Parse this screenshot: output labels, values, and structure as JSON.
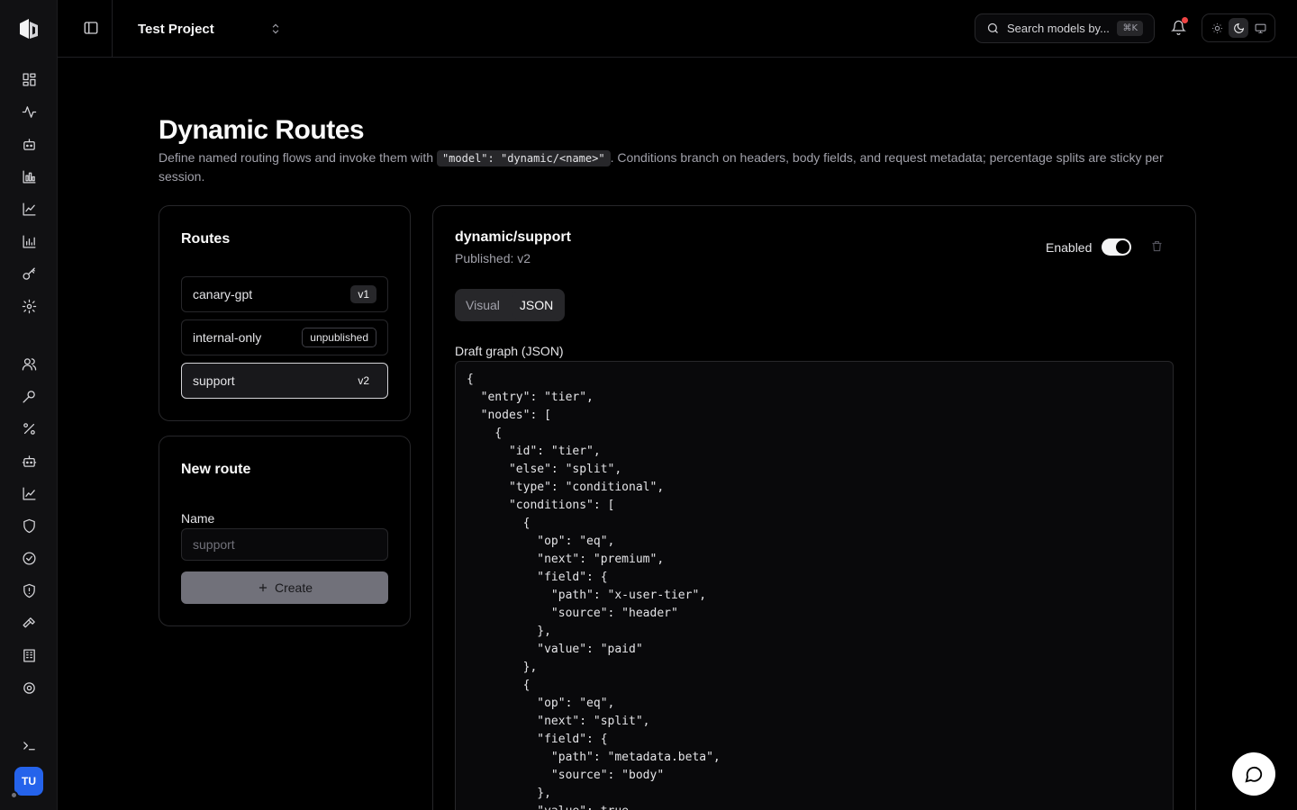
{
  "topbar": {
    "project_name": "Test Project",
    "search_placeholder": "Search models by...",
    "search_shortcut": "⌘K"
  },
  "rail": {
    "avatar_initials": "TU",
    "icons": [
      "dashboard-icon",
      "activity-icon",
      "bot-icon",
      "bar-chart-icon",
      "line-chart-icon",
      "column-chart-icon",
      "key-icon",
      "settings-icon",
      "users-icon",
      "wrench-icon",
      "percent-icon",
      "robot-icon",
      "trend-icon",
      "shield-icon",
      "check-circle-icon",
      "shield-alert-icon",
      "hammer-icon",
      "building-icon",
      "cog-icon",
      "terminal-icon"
    ]
  },
  "header": {
    "title": "Dynamic Routes",
    "desc_before": "Define named routing flows and invoke them with ",
    "desc_code": "\"model\": \"dynamic/<name>\"",
    "desc_after": ". Conditions branch on headers, body fields, and request metadata; percentage splits are sticky per session."
  },
  "routes_card": {
    "title": "Routes",
    "items": [
      {
        "name": "canary-gpt",
        "badge": "v1"
      },
      {
        "name": "internal-only",
        "badge": "unpublished"
      },
      {
        "name": "support",
        "badge": "v2"
      }
    ]
  },
  "new_route": {
    "title": "New route",
    "name_label": "Name",
    "name_placeholder": "support",
    "create_label": "Create"
  },
  "detail": {
    "title": "dynamic/support",
    "subtitle": "Published: v2",
    "enabled_label": "Enabled",
    "enabled": true,
    "tabs": [
      "Visual",
      "JSON"
    ],
    "active_tab": "JSON",
    "editor_label": "Draft graph (JSON)",
    "editor_text": "{\n  \"entry\": \"tier\",\n  \"nodes\": [\n    {\n      \"id\": \"tier\",\n      \"else\": \"split\",\n      \"type\": \"conditional\",\n      \"conditions\": [\n        {\n          \"op\": \"eq\",\n          \"next\": \"premium\",\n          \"field\": {\n            \"path\": \"x-user-tier\",\n            \"source\": \"header\"\n          },\n          \"value\": \"paid\"\n        },\n        {\n          \"op\": \"eq\",\n          \"next\": \"split\",\n          \"field\": {\n            \"path\": \"metadata.beta\",\n            \"source\": \"body\"\n          },\n          \"value\": true"
  }
}
